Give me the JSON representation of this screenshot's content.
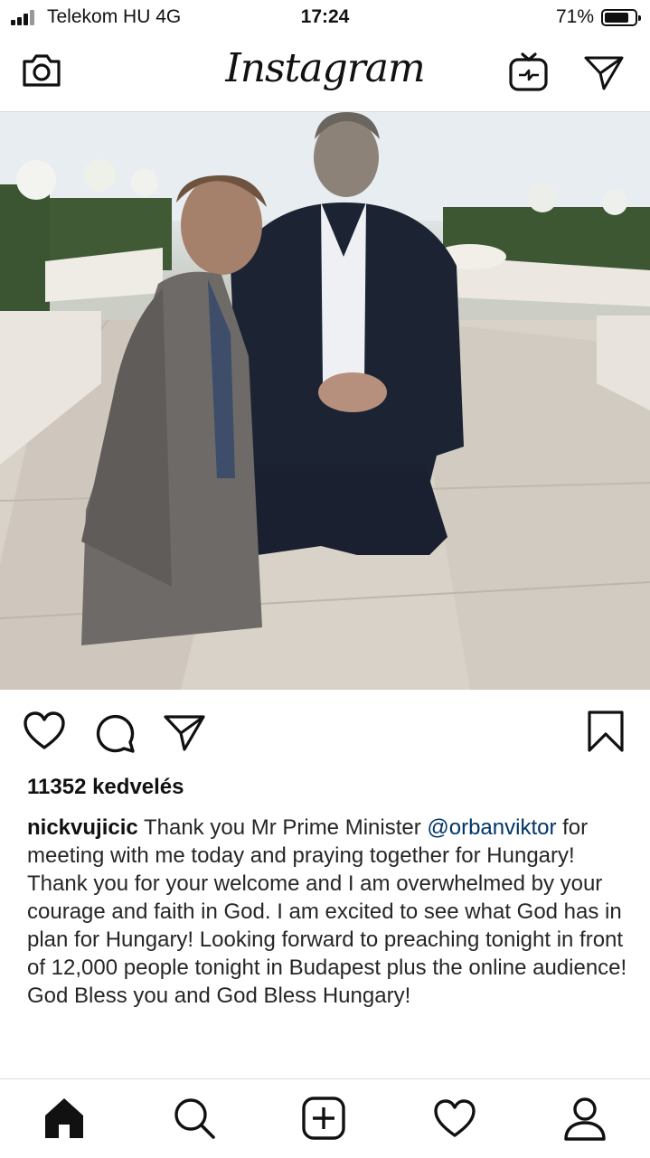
{
  "status_bar": {
    "carrier": "Telekom HU  4G",
    "time": "17:24",
    "battery": "71%",
    "battery_level": 0.71
  },
  "header": {
    "logo": "Instagram",
    "left_icon": "camera-icon",
    "right_icons": [
      "igtv-icon",
      "direct-message-icon"
    ]
  },
  "post": {
    "image_alt": "Photo of two men kneeling in prayer on a stone terrace",
    "likes": "11352 kedvelés",
    "caption": {
      "username": "nickvujicic",
      "text_before_mention": " Thank you Mr Prime Minister ",
      "mention": "@orbanviktor",
      "text_after_mention": " for meeting with me today and praying together for Hungary! Thank you for your welcome and I am overwhelmed by your courage and faith in God. I am excited to see what God has in plan for Hungary! Looking forward to preaching tonight in front of 12,000 people tonight in Budapest plus the online audience!  God Bless you and God Bless Hungary!"
    },
    "actions": [
      "like-icon",
      "comment-icon",
      "share-icon",
      "bookmark-icon"
    ]
  },
  "tab_bar": [
    "home-icon",
    "search-icon",
    "new-post-icon",
    "activity-icon",
    "profile-icon"
  ]
}
